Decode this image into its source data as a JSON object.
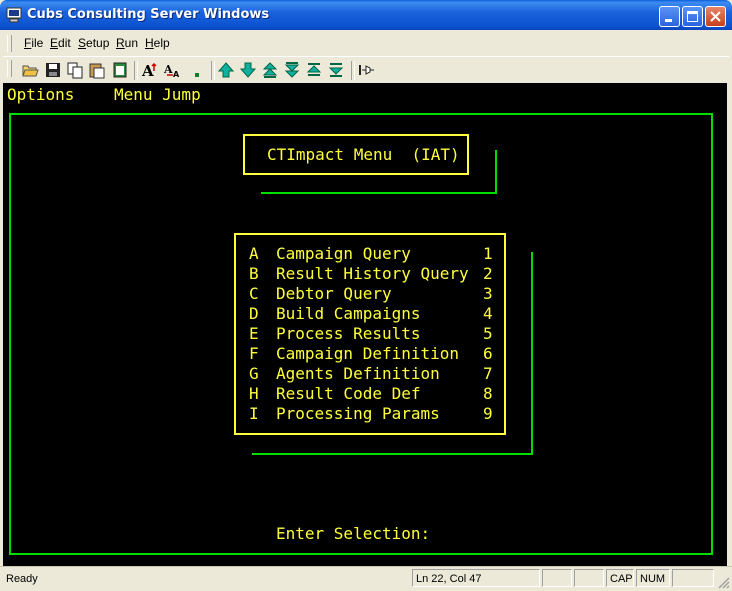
{
  "window": {
    "title": "Cubs Consulting Server Windows"
  },
  "menubar": {
    "items": [
      {
        "accel": "F",
        "rest": "ile"
      },
      {
        "accel": "E",
        "rest": "dit"
      },
      {
        "accel": "S",
        "rest": "etup"
      },
      {
        "accel": "R",
        "rest": "un"
      },
      {
        "accel": "H",
        "rest": "elp"
      }
    ]
  },
  "toolbar": {
    "icons": [
      "open-folder-icon",
      "save-icon",
      "copy-icon",
      "paste-icon",
      "clipboard-icon",
      "font-larger-icon",
      "font-smaller-icon",
      "small-font-icon",
      "arrow-up-icon",
      "arrow-down-icon",
      "page-up-icon",
      "page-down-icon",
      "top-icon",
      "bottom-icon",
      "disconnect-icon"
    ]
  },
  "terminal": {
    "top_menu": {
      "options": "Options",
      "menu_jump": "Menu Jump"
    },
    "title": "CTImpact Menu  (IAT)",
    "menu": [
      {
        "letter": "A",
        "label": "Campaign Query",
        "num": "1"
      },
      {
        "letter": "B",
        "label": "Result History Query",
        "num": "2"
      },
      {
        "letter": "C",
        "label": "Debtor Query",
        "num": "3"
      },
      {
        "letter": "D",
        "label": "Build Campaigns",
        "num": "4"
      },
      {
        "letter": "E",
        "label": "Process Results",
        "num": "5"
      },
      {
        "letter": "F",
        "label": "Campaign Definition",
        "num": "6"
      },
      {
        "letter": "G",
        "label": "Agents Definition",
        "num": "7"
      },
      {
        "letter": "H",
        "label": "Result Code Def",
        "num": "8"
      },
      {
        "letter": "I",
        "label": "Processing Params",
        "num": "9"
      }
    ],
    "prompt": "Enter Selection:"
  },
  "statusbar": {
    "ready": "Ready",
    "position": "Ln 22, Col 47",
    "cap": "CAP",
    "num": "NUM"
  },
  "colors": {
    "terminal_bg": "#000000",
    "terminal_text": "#ffff3c",
    "border_green": "#00dd00"
  }
}
